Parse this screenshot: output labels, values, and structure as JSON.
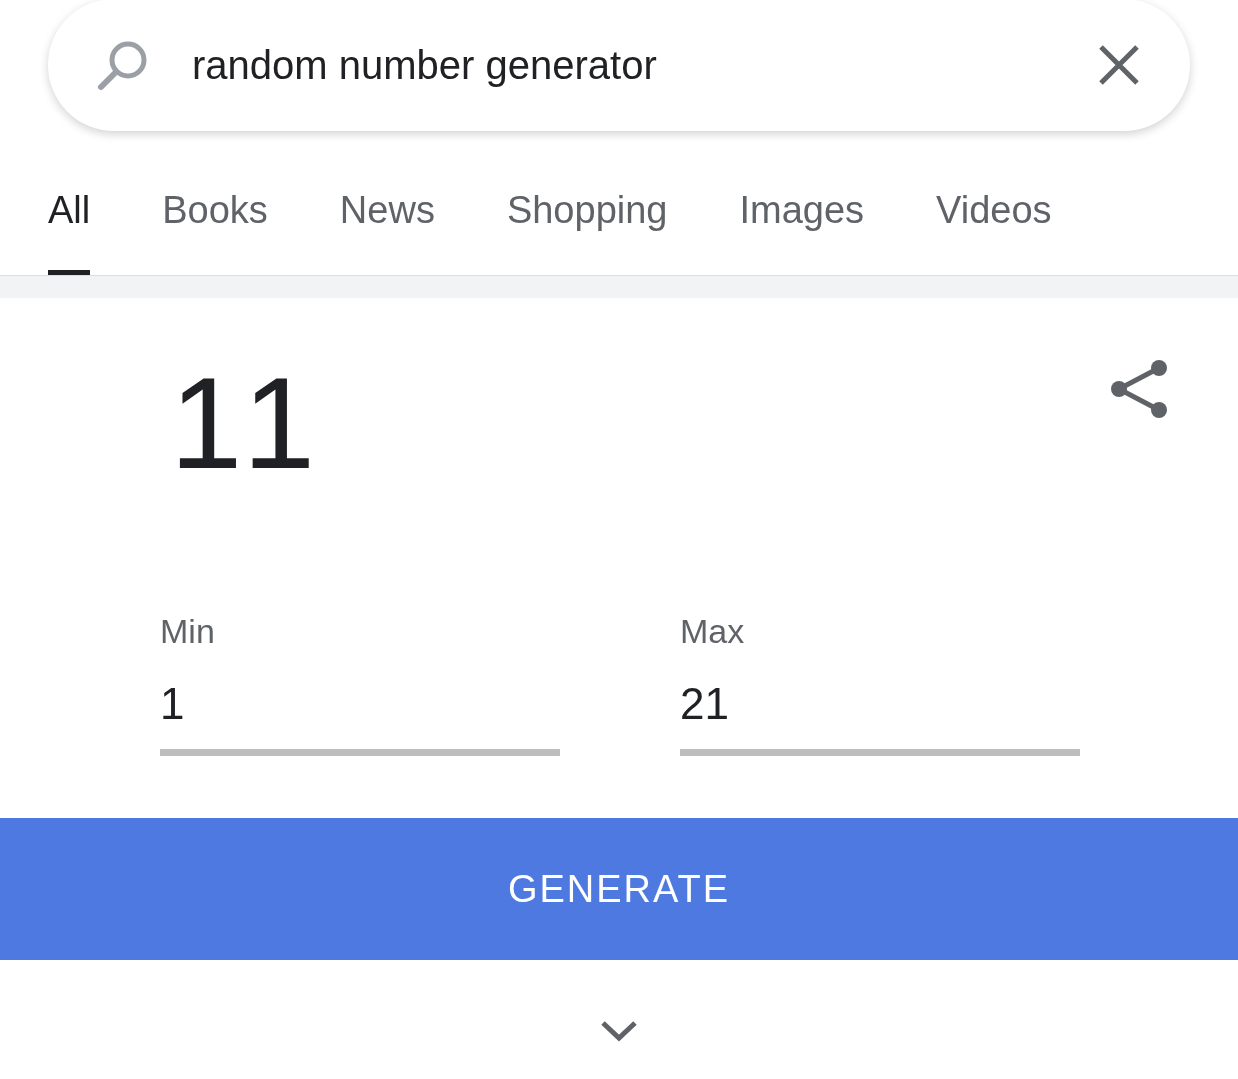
{
  "search": {
    "value": "random number generator"
  },
  "tabs": [
    {
      "label": "All",
      "selected": true
    },
    {
      "label": "Books",
      "selected": false
    },
    {
      "label": "News",
      "selected": false
    },
    {
      "label": "Shopping",
      "selected": false
    },
    {
      "label": "Images",
      "selected": false
    },
    {
      "label": "Videos",
      "selected": false
    }
  ],
  "generator": {
    "result": "11",
    "fields": [
      {
        "label": "Min",
        "value": "1"
      },
      {
        "label": "Max",
        "value": "21"
      }
    ],
    "button": "GENERATE"
  }
}
